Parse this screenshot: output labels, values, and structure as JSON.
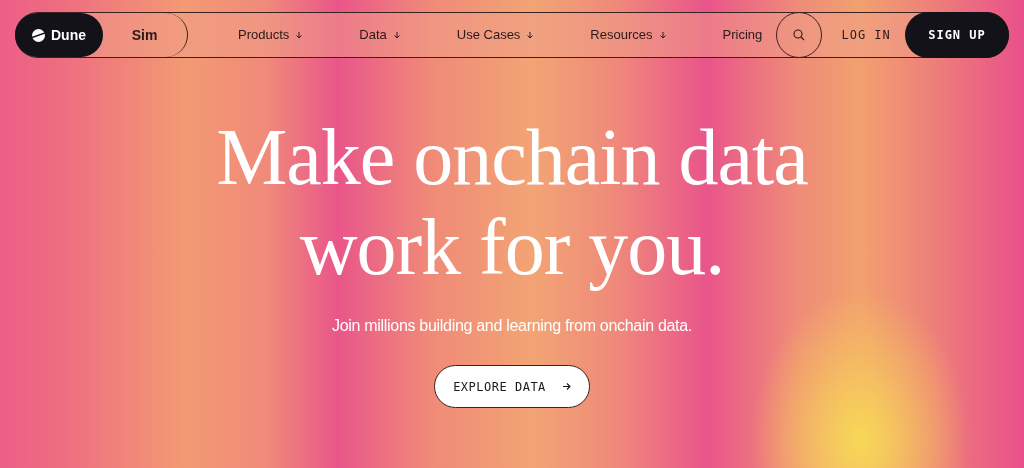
{
  "nav": {
    "brand": "Dune",
    "secondary": "Sim",
    "items": [
      {
        "label": "Products",
        "dropdown": true
      },
      {
        "label": "Data",
        "dropdown": true
      },
      {
        "label": "Use Cases",
        "dropdown": true
      },
      {
        "label": "Resources",
        "dropdown": true
      },
      {
        "label": "Pricing",
        "dropdown": false
      }
    ],
    "login": "LOG IN",
    "signup": "SIGN UP"
  },
  "hero": {
    "headline": [
      "Make onchain data",
      "work for you."
    ],
    "subtitle": "Join millions building and learning from onchain data.",
    "cta": "EXPLORE DATA"
  }
}
